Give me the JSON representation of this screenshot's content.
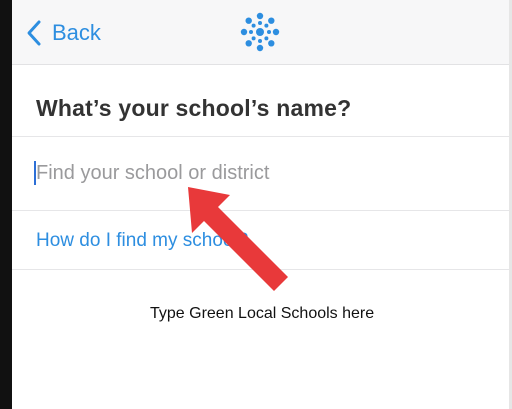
{
  "nav": {
    "back_label": "Back",
    "logo_icon": "canvas-logo-icon",
    "accent_color": "#2d8ee0"
  },
  "page": {
    "title": "What’s your school’s name?"
  },
  "search": {
    "placeholder": "Find your school or district",
    "value": ""
  },
  "help": {
    "link_label": "How do I find my school?"
  },
  "annotation": {
    "instruction": "Type Green Local Schools here",
    "arrow_icon": "red-arrow-icon",
    "arrow_color": "#e8393a"
  }
}
